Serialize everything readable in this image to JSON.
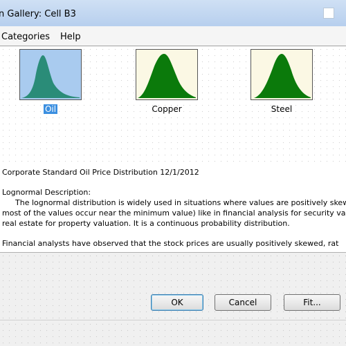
{
  "window": {
    "title": "n Gallery: Cell B3"
  },
  "menu": {
    "categories": "Categories",
    "help": "Help"
  },
  "gallery": {
    "items": [
      {
        "label": "Oil",
        "bg": "#a9cbef",
        "fill": "#2a8c78",
        "selected": true
      },
      {
        "label": "Copper",
        "bg": "#fbf8e4",
        "fill": "#0b7a0b",
        "selected": false
      },
      {
        "label": "Steel",
        "bg": "#fbf8e4",
        "fill": "#0b7a0b",
        "selected": false
      }
    ]
  },
  "description": {
    "line1": "Corporate Standard Oil Price Distribution 12/1/2012",
    "heading": "Lognormal Description:",
    "para1": "The lognormal distribution is widely used in situations where values are positively skewed",
    "para2": "most of the values occur near the minimum value) like in financial analysis for security va",
    "para3": "real estate for property valuation. It is a continuous probability distribution.",
    "para4": "Financial analysts have observed that the stock prices are usually positively skewed, rat"
  },
  "buttons": {
    "ok": "OK",
    "cancel": "Cancel",
    "fit": "Fit..."
  }
}
